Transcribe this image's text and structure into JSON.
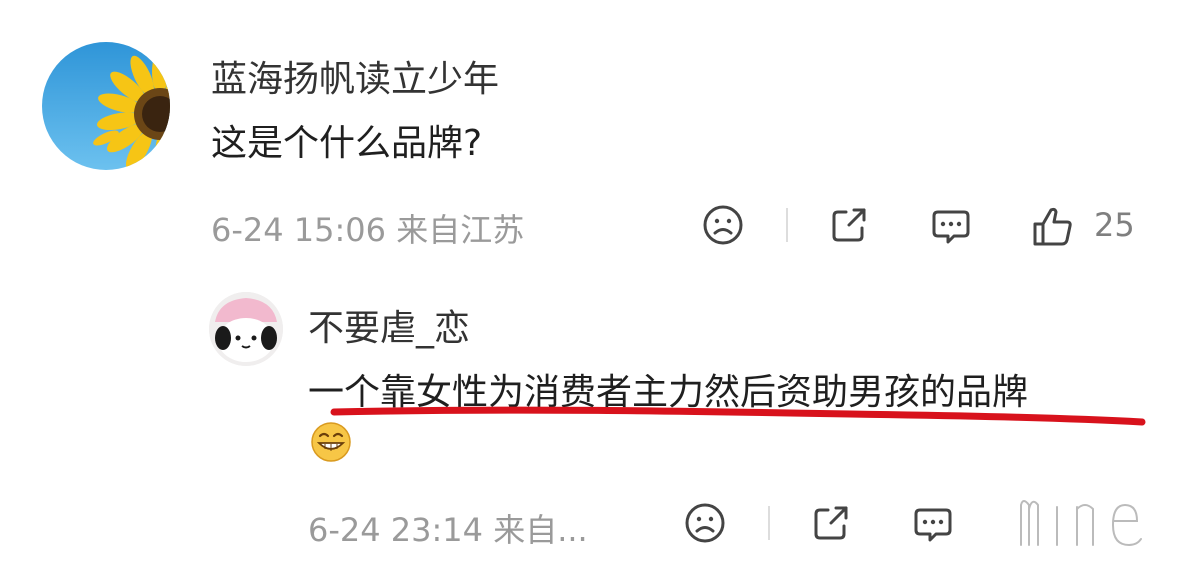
{
  "comment": {
    "username": "蓝海扬帆读立少年",
    "text": "这是个什么品牌?",
    "meta": "6-24 15:06 来自江苏",
    "like_count": "25",
    "avatar_icon": "sunflower-avatar"
  },
  "reply": {
    "username": "不要虐_恋",
    "text": "一个靠女性为消费者主力然后资助男孩的品牌",
    "emoji_icon": "grinning-emoji",
    "meta": "6-24 23:14 来自...",
    "avatar_icon": "panda-avatar",
    "underline_color": "#d8121c"
  },
  "icons": [
    "dislike-face-icon",
    "share-icon",
    "comment-icon",
    "like-thumb-icon"
  ],
  "watermark": "mine"
}
